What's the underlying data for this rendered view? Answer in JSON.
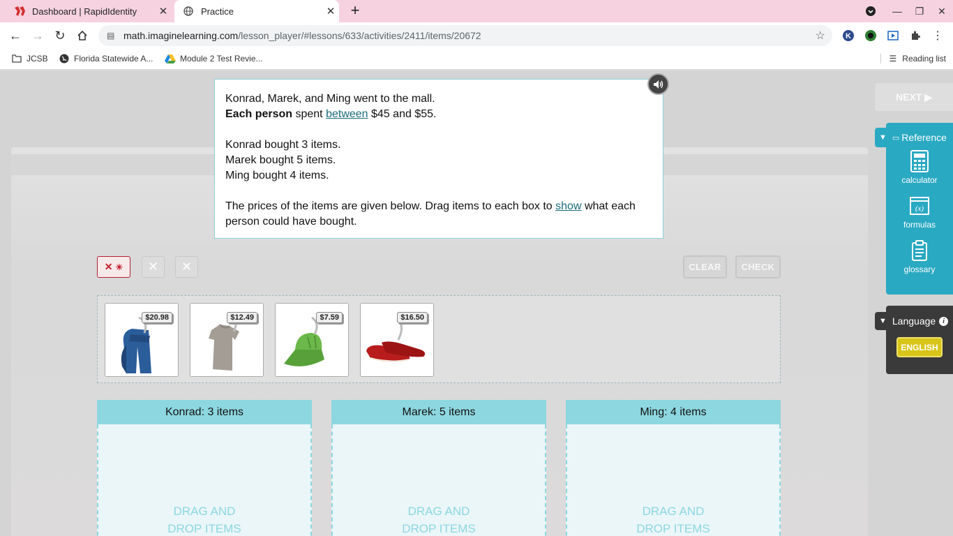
{
  "browser": {
    "tabs": [
      {
        "title": "Dashboard | RapidIdentity",
        "active": false
      },
      {
        "title": "Practice",
        "active": true
      }
    ],
    "url_host": "math.imaginelearning.com",
    "url_path": "/lesson_player/#lessons/633/activities/2411/items/20672",
    "bookmarks": [
      "JCSB",
      "Florida Statewide A...",
      "Module 2 Test Revie..."
    ],
    "reading_list": "Reading list"
  },
  "question": {
    "line1": "Konrad, Marek, and Ming went to the mall.",
    "line2_bold": "Each person",
    "line2_spent": "spent",
    "line2_link": "between",
    "line2_rest": "$45 and $55.",
    "konrad_line": "Konrad bought 3 items.",
    "marek_line": "Marek bought 5 items.",
    "ming_line": "Ming bought 4 items.",
    "instr_start": "The prices of the items are given below. Drag items to each box to",
    "instr_link": "show",
    "instr_end": "what each person could have bought."
  },
  "controls": {
    "clear": "CLEAR",
    "check": "CHECK",
    "next": "NEXT ▶"
  },
  "items": [
    {
      "name": "jeans",
      "price": "$20.98"
    },
    {
      "name": "t-shirt",
      "price": "$12.49"
    },
    {
      "name": "cap",
      "price": "$7.59"
    },
    {
      "name": "shoes",
      "price": "$16.50"
    }
  ],
  "drop_boxes": [
    {
      "header": "Konrad: 3 items",
      "placeholder_1": "DRAG AND",
      "placeholder_2": "DROP ITEMS"
    },
    {
      "header": "Marek: 5 items",
      "placeholder_1": "DRAG AND",
      "placeholder_2": "DROP ITEMS"
    },
    {
      "header": "Ming: 4 items",
      "placeholder_1": "DRAG AND",
      "placeholder_2": "DROP ITEMS"
    }
  ],
  "reference": {
    "title": "Reference",
    "items": [
      {
        "label": "calculator",
        "icon": "calculator-icon"
      },
      {
        "label": "formulas",
        "icon": "formulas-icon"
      },
      {
        "label": "glossary",
        "icon": "glossary-icon"
      }
    ]
  },
  "language": {
    "title": "Language",
    "button": "ENGLISH"
  },
  "colors": {
    "accent_teal": "#2aa9c2",
    "dropbox_header": "#8dd7e0",
    "language_button": "#d8c51a",
    "hint_red": "#c0202c",
    "tabstrip_pink": "#f6d2e0"
  }
}
